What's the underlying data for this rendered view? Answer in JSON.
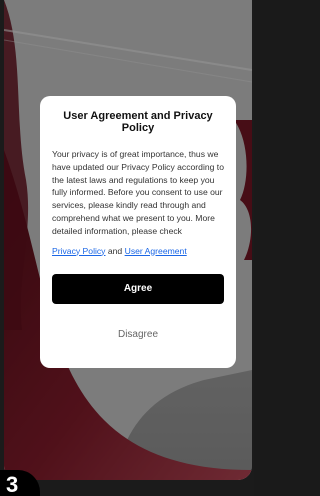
{
  "dialog": {
    "title": "User Agreement and Privacy Policy",
    "body": "Your privacy is of great importance, thus we have updated our Privacy Policy according to the latest laws and regulations to keep you fully informed. Before you consent to use our services, please kindly read through and comprehend what we present to you. More detailed information, please check",
    "privacy_link": "Privacy Policy",
    "and_text": "and",
    "user_agreement_link": "User Agreement",
    "agree_label": "Agree",
    "disagree_label": "Disagree"
  },
  "badge": {
    "number": "3"
  },
  "colors": {
    "link": "#1a66e6",
    "primary_button": "#000000",
    "background_accent": "#8b1e2e"
  },
  "icons": {
    "background": "wine-glass-image"
  }
}
